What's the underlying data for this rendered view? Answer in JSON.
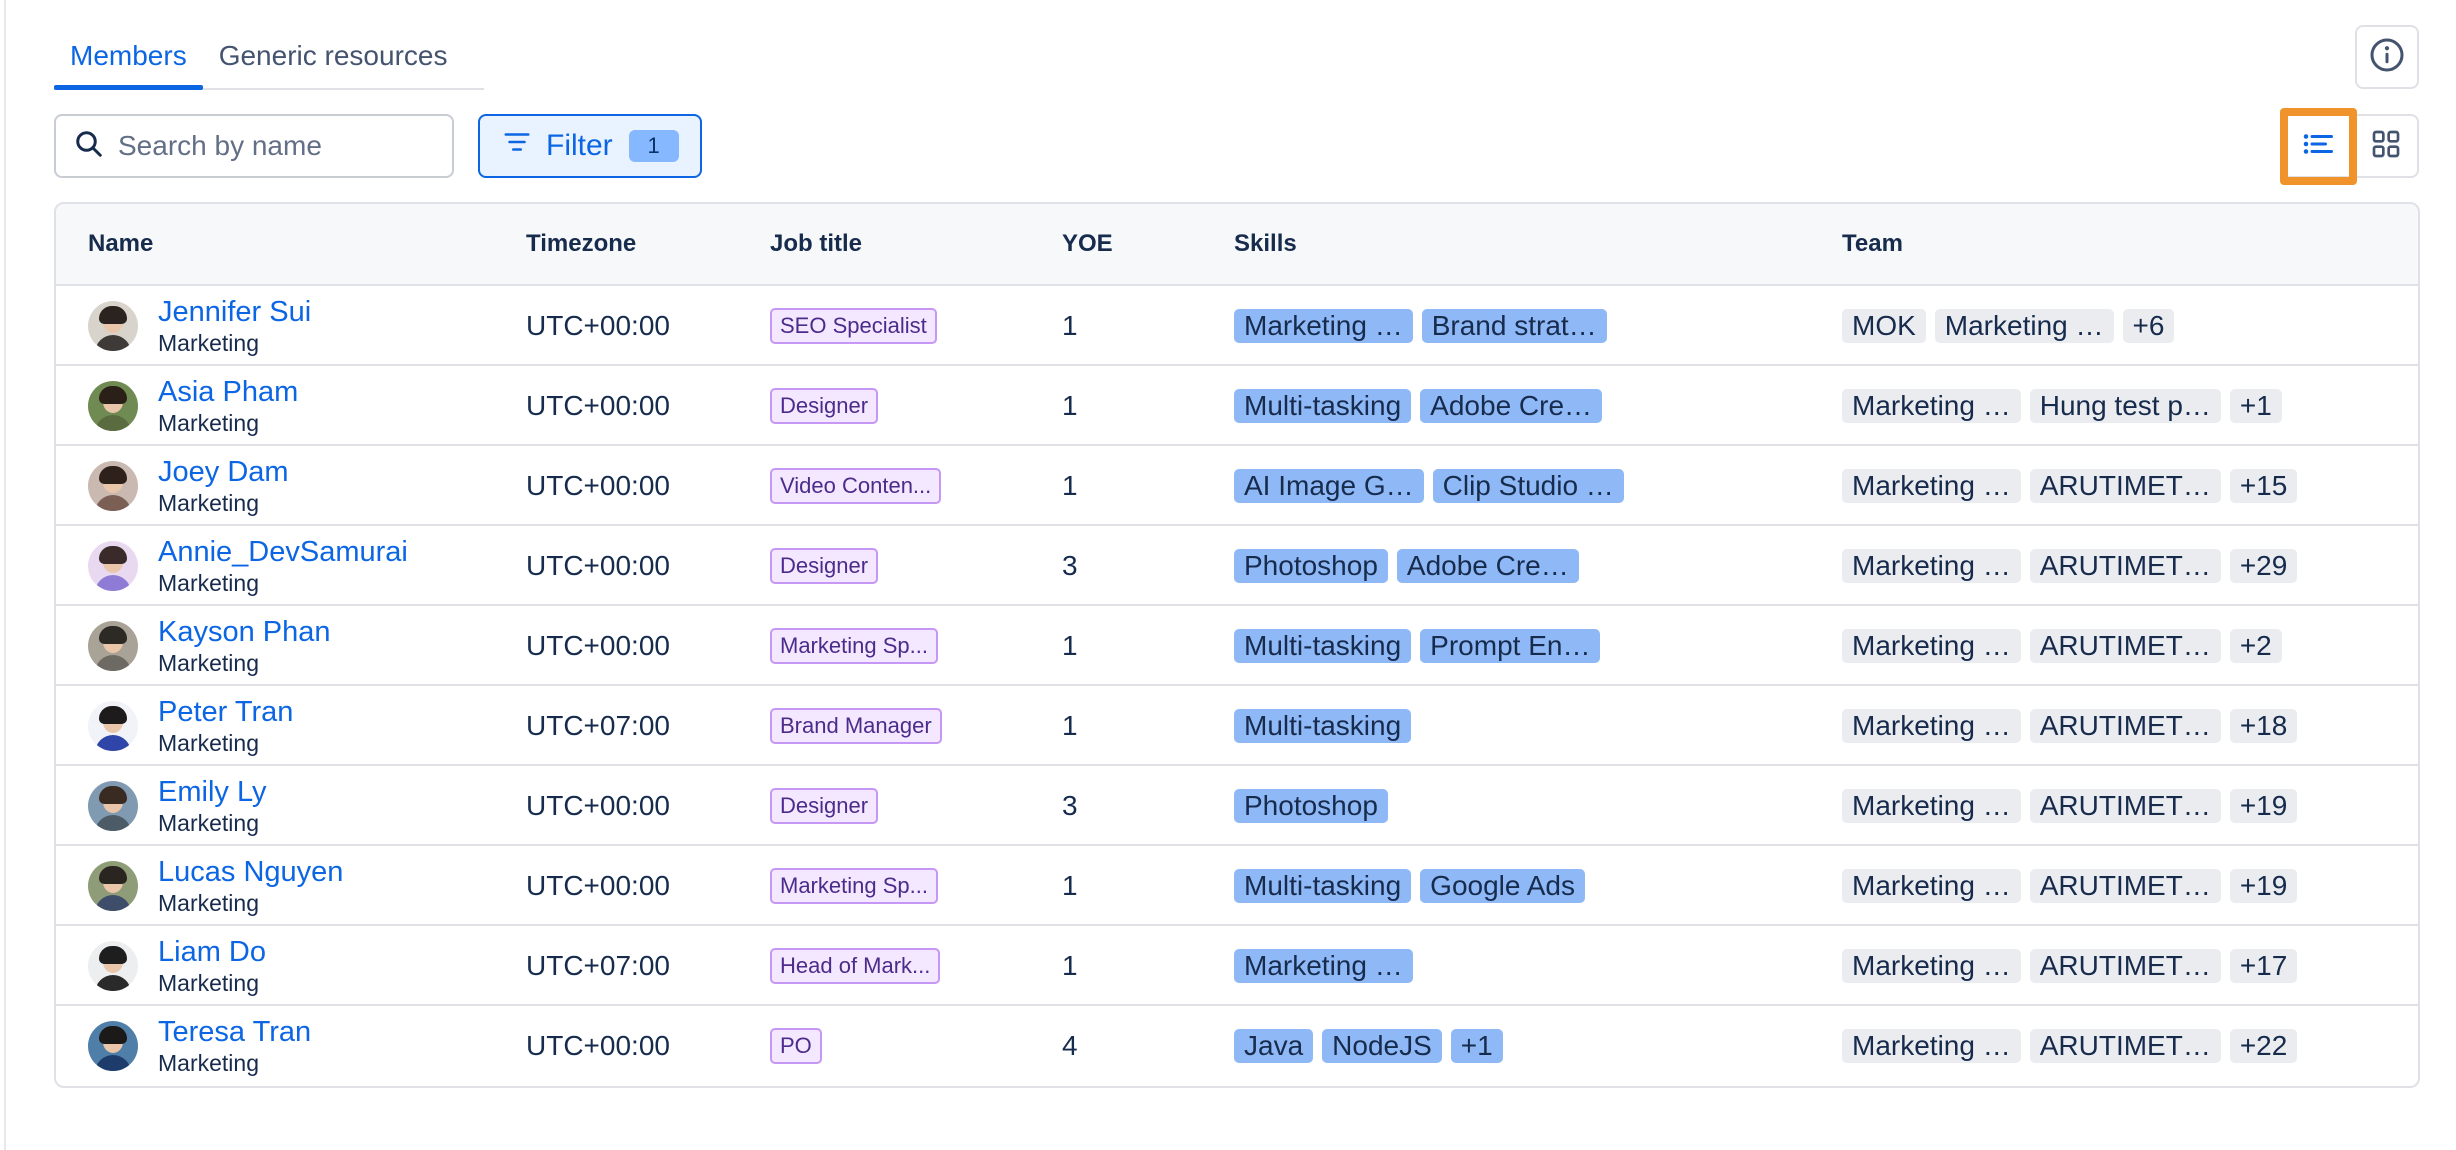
{
  "tabs": [
    {
      "label": "Members",
      "active": true
    },
    {
      "label": "Generic resources",
      "active": false
    }
  ],
  "search": {
    "placeholder": "Search by name",
    "value": ""
  },
  "filter": {
    "label": "Filter",
    "count": "1"
  },
  "view": {
    "active": "list",
    "options": [
      "list",
      "grid"
    ]
  },
  "table": {
    "headers": [
      "Name",
      "Timezone",
      "Job title",
      "YOE",
      "Skills",
      "Team"
    ],
    "rows": [
      {
        "name": "Jennifer Sui",
        "dept": "Marketing",
        "timezone": "UTC+00:00",
        "job": "SEO Specialist",
        "yoe": "1",
        "skills": [
          "Marketing …",
          "Brand strat…"
        ],
        "team": [
          "MOK",
          "Marketing …",
          "+6"
        ]
      },
      {
        "name": "Asia Pham",
        "dept": "Marketing",
        "timezone": "UTC+00:00",
        "job": "Designer",
        "yoe": "1",
        "skills": [
          "Multi-tasking",
          "Adobe Cre…"
        ],
        "team": [
          "Marketing …",
          "Hung test p…",
          "+1"
        ]
      },
      {
        "name": "Joey Dam",
        "dept": "Marketing",
        "timezone": "UTC+00:00",
        "job": "Video Conten...",
        "yoe": "1",
        "skills": [
          "AI Image G…",
          "Clip Studio …"
        ],
        "team": [
          "Marketing …",
          "ARUTIMET…",
          "+15"
        ]
      },
      {
        "name": "Annie_DevSamurai",
        "dept": "Marketing",
        "timezone": "UTC+00:00",
        "job": "Designer",
        "yoe": "3",
        "skills": [
          "Photoshop",
          "Adobe Cre…"
        ],
        "team": [
          "Marketing …",
          "ARUTIMET…",
          "+29"
        ]
      },
      {
        "name": "Kayson Phan",
        "dept": "Marketing",
        "timezone": "UTC+00:00",
        "job": "Marketing Sp...",
        "yoe": "1",
        "skills": [
          "Multi-tasking",
          "Prompt En…"
        ],
        "team": [
          "Marketing …",
          "ARUTIMET…",
          "+2"
        ]
      },
      {
        "name": "Peter Tran",
        "dept": "Marketing",
        "timezone": "UTC+07:00",
        "job": "Brand Manager",
        "yoe": "1",
        "skills": [
          "Multi-tasking"
        ],
        "team": [
          "Marketing …",
          "ARUTIMET…",
          "+18"
        ]
      },
      {
        "name": "Emily Ly",
        "dept": "Marketing",
        "timezone": "UTC+00:00",
        "job": "Designer",
        "yoe": "3",
        "skills": [
          "Photoshop"
        ],
        "team": [
          "Marketing …",
          "ARUTIMET…",
          "+19"
        ]
      },
      {
        "name": "Lucas Nguyen",
        "dept": "Marketing",
        "timezone": "UTC+00:00",
        "job": "Marketing Sp...",
        "yoe": "1",
        "skills": [
          "Multi-tasking",
          "Google Ads"
        ],
        "team": [
          "Marketing …",
          "ARUTIMET…",
          "+19"
        ]
      },
      {
        "name": "Liam Do",
        "dept": "Marketing",
        "timezone": "UTC+07:00",
        "job": "Head of Mark...",
        "yoe": "1",
        "skills": [
          "Marketing …"
        ],
        "team": [
          "Marketing …",
          "ARUTIMET…",
          "+17"
        ]
      },
      {
        "name": "Teresa Tran",
        "dept": "Marketing",
        "timezone": "UTC+00:00",
        "job": "PO",
        "yoe": "4",
        "skills": [
          "Java",
          "NodeJS",
          "+1"
        ],
        "team": [
          "Marketing …",
          "ARUTIMET…",
          "+22"
        ]
      }
    ]
  },
  "colors": {
    "accent": "#0c66e4",
    "highlight": "#f0932b",
    "skill_tag": "#8fb8f6",
    "job_tag_bg": "#f3e8ff",
    "job_tag_border": "#c797f5",
    "team_tag": "#ebecf0"
  },
  "icons": {
    "info": "info-icon",
    "search": "search-icon",
    "filter": "filter-icon",
    "list_view": "list-view-icon",
    "grid_view": "grid-view-icon"
  }
}
